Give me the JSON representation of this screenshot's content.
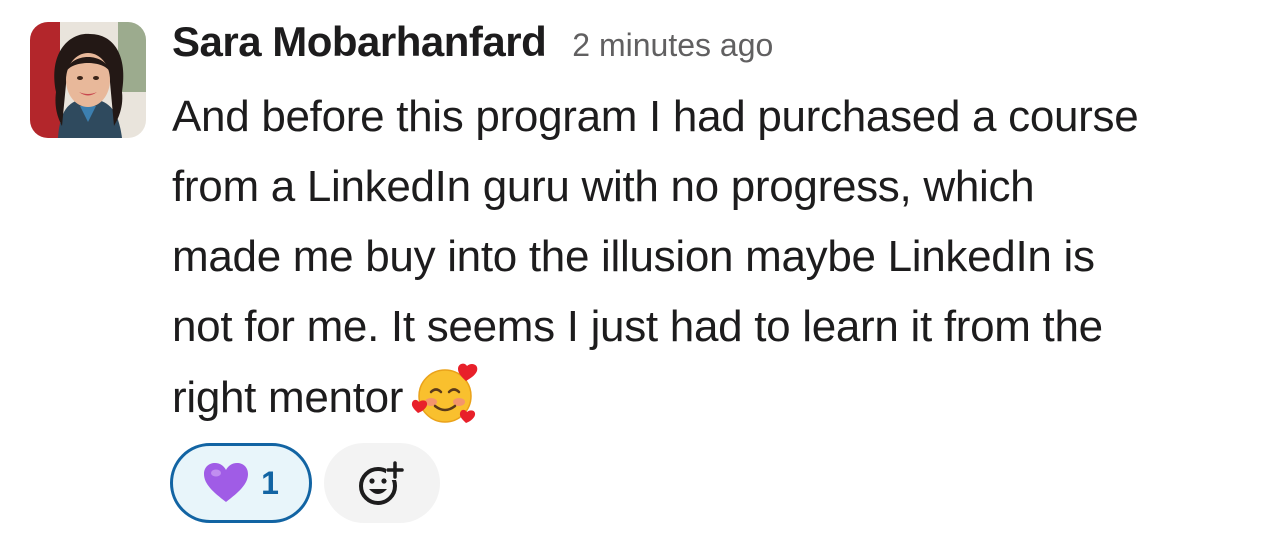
{
  "message": {
    "author": "Sara Mobarhanfard",
    "timestamp": "2 minutes ago",
    "lines": [
      "And before this program I had purchased a course",
      "from a LinkedIn guru with no progress, which",
      "made me buy into the illusion maybe LinkedIn is",
      "not for me. It seems I just had to learn it from the",
      "right mentor"
    ],
    "emoji": "smiling-face-with-hearts-icon"
  },
  "reactions": [
    {
      "emoji": "purple-heart-icon",
      "count": "1",
      "reacted_by_me": true
    }
  ],
  "add_reaction": {
    "icon": "add-reaction-icon"
  },
  "colors": {
    "accent_border": "#1264a3",
    "accent_bg": "#e8f5fa",
    "text": "#1d1c1d",
    "muted": "#616061",
    "add_reaction_bg": "#f3f3f3"
  }
}
